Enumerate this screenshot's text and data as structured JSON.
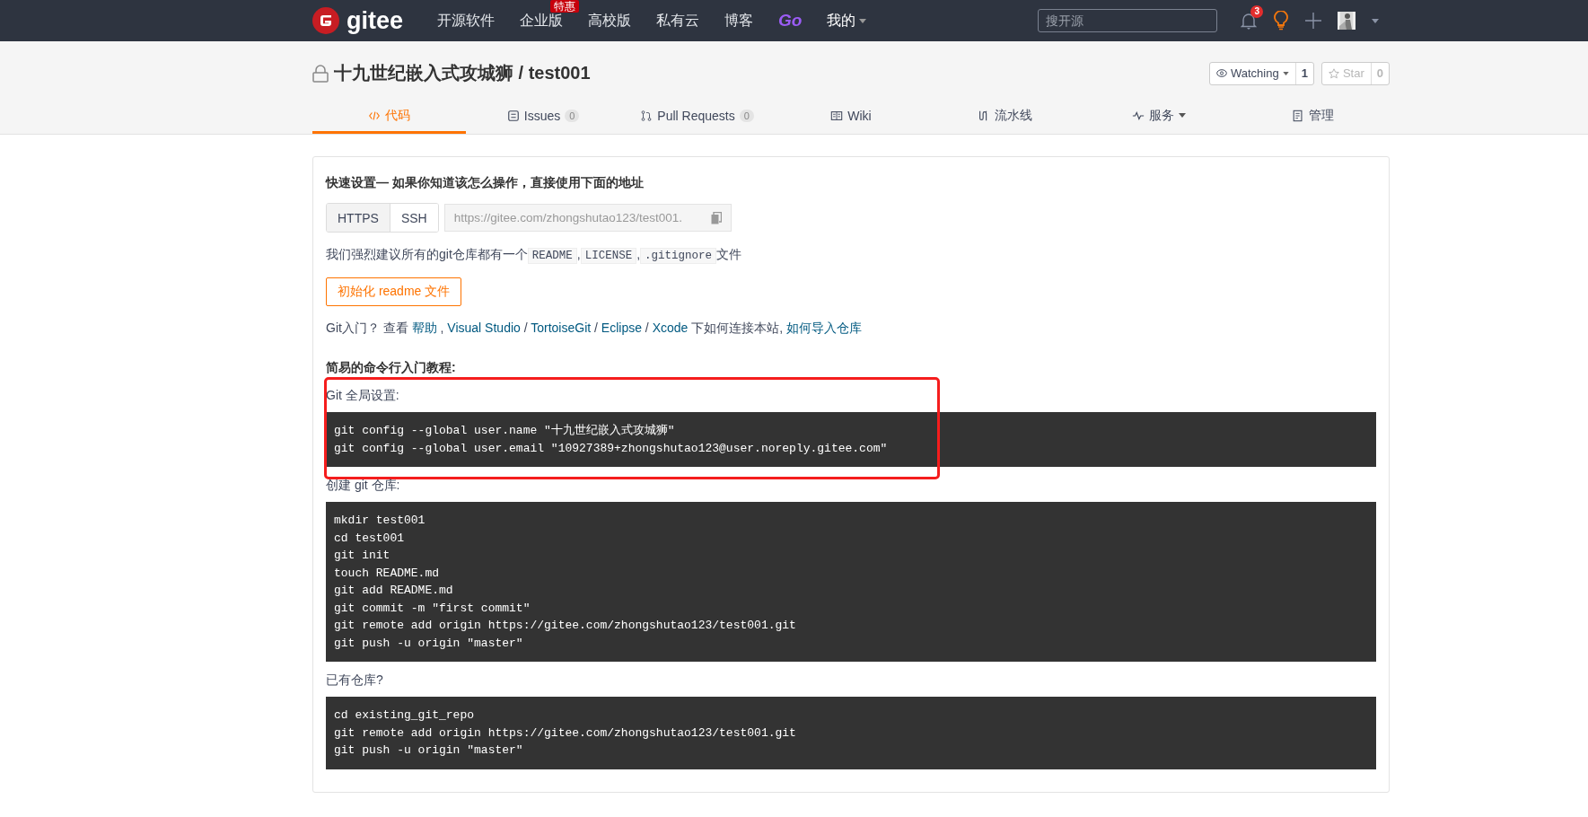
{
  "header": {
    "logo": "gitee",
    "nav": [
      {
        "label": "开源软件"
      },
      {
        "label": "企业版",
        "badge": "特惠"
      },
      {
        "label": "高校版"
      },
      {
        "label": "私有云"
      },
      {
        "label": "博客"
      },
      {
        "label": "Go",
        "kind": "go"
      },
      {
        "label": "我的",
        "kind": "menu"
      }
    ],
    "search": {
      "placeholder": "搜开源"
    },
    "notifications": "3"
  },
  "repo": {
    "title": "十九世纪嵌入式攻城狮 / test001",
    "watch": {
      "label": "Watching",
      "count": "1"
    },
    "star": {
      "label": "Star",
      "count": "0"
    }
  },
  "tabs": [
    {
      "label": "代码",
      "selected": true
    },
    {
      "label": "Issues",
      "count": "0",
      "selected": false
    },
    {
      "label": "Pull Requests",
      "count": "0",
      "selected": false
    },
    {
      "label": "Wiki",
      "selected": false
    },
    {
      "label": "流水线",
      "selected": false
    },
    {
      "label": "服务",
      "caret": true,
      "selected": false
    },
    {
      "label": "管理",
      "selected": false
    }
  ],
  "setup": {
    "heading": "快速设置— 如果你知道该怎么操作，直接使用下面的地址",
    "protocols": [
      {
        "label": "HTTPS",
        "selected": true
      },
      {
        "label": "SSH",
        "selected": false
      }
    ],
    "url": "https://gitee.com/zhongshutao123/test001.",
    "recommend": [
      {
        "kind": "text",
        "text": "我们强烈建议所有的git仓库都有一个"
      },
      {
        "kind": "code",
        "text": "README"
      },
      {
        "kind": "text",
        "text": ","
      },
      {
        "kind": "code",
        "text": "LICENSE"
      },
      {
        "kind": "text",
        "text": ","
      },
      {
        "kind": "code",
        "text": ".gitignore"
      },
      {
        "kind": "text",
        "text": "文件"
      }
    ],
    "init_button": "初始化 readme 文件",
    "intro": [
      {
        "kind": "text",
        "text": "Git入门？ 查看 "
      },
      {
        "kind": "link",
        "text": "帮助"
      },
      {
        "kind": "text",
        "text": " , "
      },
      {
        "kind": "link",
        "text": "Visual Studio"
      },
      {
        "kind": "text",
        "text": " / "
      },
      {
        "kind": "link",
        "text": "TortoiseGit"
      },
      {
        "kind": "text",
        "text": " / "
      },
      {
        "kind": "link",
        "text": "Eclipse"
      },
      {
        "kind": "text",
        "text": " / "
      },
      {
        "kind": "link",
        "text": "Xcode"
      },
      {
        "kind": "text",
        "text": " 下如何连接本站, "
      },
      {
        "kind": "link",
        "text": "如何导入仓库"
      }
    ],
    "tutorial_heading": "简易的命令行入门教程:",
    "sections": [
      {
        "label": "Git 全局设置:",
        "highlighted": true,
        "lines": [
          "git config --global user.name \"十九世纪嵌入式攻城狮\"",
          "git config --global user.email \"10927389+zhongshutao123@user.noreply.gitee.com\""
        ]
      },
      {
        "label": "创建 git 仓库:",
        "lines": [
          "mkdir test001",
          "cd test001",
          "git init",
          "touch README.md",
          "git add README.md",
          "git commit -m \"first commit\"",
          "git remote add origin https://gitee.com/zhongshutao123/test001.git",
          "git push -u origin \"master\""
        ]
      },
      {
        "label": "已有仓库?",
        "lines": [
          "cd existing_git_repo",
          "git remote add origin https://gitee.com/zhongshutao123/test001.git",
          "git push -u origin \"master\""
        ]
      }
    ]
  }
}
